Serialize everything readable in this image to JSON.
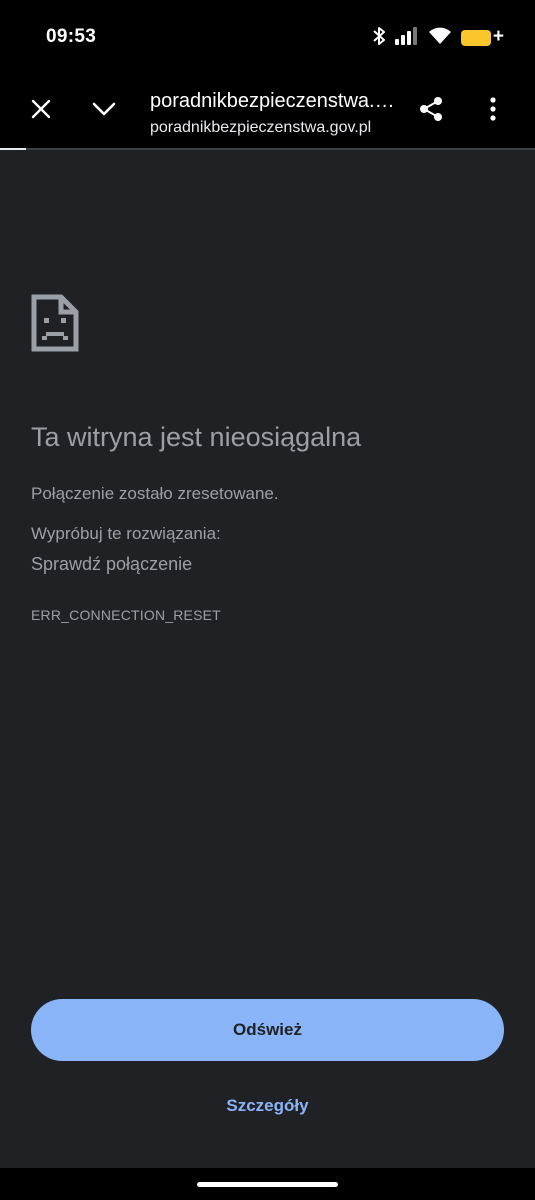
{
  "status_bar": {
    "time": "09:53",
    "icons": [
      "bluetooth-icon",
      "signal-icon",
      "wifi-icon",
      "battery-icon"
    ],
    "battery_color": "#f9c62c",
    "battery_plus": "+"
  },
  "toolbar": {
    "close_icon": "close-icon",
    "collapse_icon": "chevron-down-icon",
    "page_title": "poradnikbezpieczenstwa.gov.pl",
    "page_domain": "poradnikbezpieczenstwa.gov.pl",
    "share_icon": "share-icon",
    "menu_icon": "more-vert-icon"
  },
  "error": {
    "icon": "broken-page-icon",
    "title": "Ta witryna jest nieosiągalna",
    "message": "Połączenie zostało zresetowane.",
    "try_label": "Wypróbuj te rozwiązania:",
    "suggestion": "Sprawdź połączenie",
    "code": "ERR_CONNECTION_RESET"
  },
  "actions": {
    "reload_label": "Odśwież",
    "details_label": "Szczegóły"
  },
  "colors": {
    "background": "#202124",
    "accent": "#8ab4f8",
    "text_secondary": "#9aa0a6"
  }
}
